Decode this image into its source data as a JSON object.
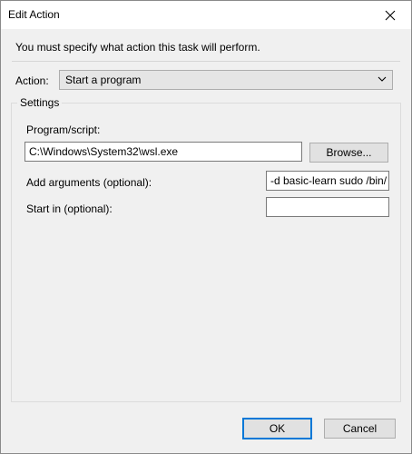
{
  "window": {
    "title": "Edit Action"
  },
  "instruction": "You must specify what action this task will perform.",
  "action": {
    "label": "Action:",
    "selected": "Start a program"
  },
  "settings": {
    "group_title": "Settings",
    "program_label": "Program/script:",
    "program_value": "C:\\Windows\\System32\\wsl.exe",
    "browse_label": "Browse...",
    "arguments_label": "Add arguments (optional):",
    "arguments_value": "-d basic-learn sudo /bin/",
    "start_in_label": "Start in (optional):",
    "start_in_value": ""
  },
  "buttons": {
    "ok": "OK",
    "cancel": "Cancel"
  },
  "icons": {
    "close": "close-icon",
    "dropdown": "chevron-down-icon"
  },
  "colors": {
    "accent": "#0078d7"
  }
}
